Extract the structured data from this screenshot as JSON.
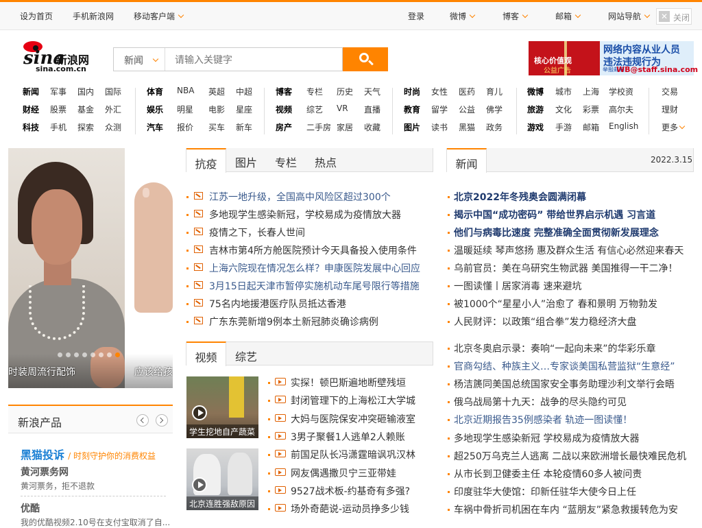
{
  "topbar": {
    "home": "设为首页",
    "mobile_sina": "手机新浪网",
    "mobile_client": "移动客户端",
    "login": "登录",
    "weibo": "微博",
    "blog": "博客",
    "mail": "邮箱",
    "site_nav": "网站导航",
    "close": "关闭",
    "close_x": "✕"
  },
  "logo": {
    "brand_sina": "sina",
    "brand_cn": "新浪网",
    "domain": "sina.com.cn"
  },
  "search": {
    "category": "新闻",
    "placeholder": "请输入关键字"
  },
  "ad": {
    "left_line1": "核心价值观",
    "left_line2": "公益广告",
    "right_line1": "网络内容从业人员",
    "right_line2": "违法违规行为",
    "right_email": "WB@staff.sina.com",
    "right_tag": "举报邮箱"
  },
  "nav": {
    "g1": [
      [
        "新闻",
        "军事",
        "国内",
        "国际"
      ],
      [
        "财经",
        "股票",
        "基金",
        "外汇"
      ],
      [
        "科技",
        "手机",
        "探索",
        "众测"
      ]
    ],
    "g2": [
      [
        "体育",
        "NBA",
        "英超",
        "中超"
      ],
      [
        "娱乐",
        "明星",
        "电影",
        "星座"
      ],
      [
        "汽车",
        "报价",
        "买车",
        "新车"
      ]
    ],
    "g3": [
      [
        "博客",
        "专栏",
        "历史",
        "天气"
      ],
      [
        "视频",
        "综艺",
        "VR",
        "直播"
      ],
      [
        "房产",
        "二手房",
        "家居",
        "收藏"
      ]
    ],
    "g4": [
      [
        "时尚",
        "女性",
        "医药",
        "育儿"
      ],
      [
        "教育",
        "留学",
        "公益",
        "佛学"
      ],
      [
        "图片",
        "读书",
        "黑猫",
        "政务"
      ]
    ],
    "g5": [
      [
        "微博",
        "城市",
        "上海",
        "学校资"
      ],
      [
        "旅游",
        "文化",
        "彩票",
        "高尔夫"
      ],
      [
        "游戏",
        "手游",
        "邮箱",
        "English"
      ]
    ],
    "g6": [
      "交易",
      "理财",
      "更多"
    ]
  },
  "carousel": {
    "caption1": "时装周流行配饰",
    "caption2": "应该给孩"
  },
  "products": {
    "title": "新浪产品",
    "items": [
      {
        "name": "黑猫投诉",
        "slogan": "/ 时刻守护你的消费权益"
      },
      {
        "name": "黄河票务网",
        "desc": "黄河票务，拒不退款"
      },
      {
        "name": "优酷",
        "desc": "我的优酷视频2.10号在支付宝取消了自..."
      }
    ]
  },
  "left_tabs": [
    "抗疫",
    "图片",
    "专栏",
    "热点"
  ],
  "left_news": [
    "江苏一地升级，全国高中风险区超过300个",
    "多地现学生感染新冠，学校易成为疫情放大器",
    "疫情之下，长春人世间",
    "吉林市第4所方舱医院预计今天具备投入使用条件",
    "上海六院现在情况怎么样？申康医院发展中心回应",
    "3月15日起天津市暂停实施机动车尾号限行等措施",
    "75名内地援港医疗队员抵达香港",
    "广东东莞新增9例本土新冠肺炎确诊病例"
  ],
  "video_tabs": [
    "视频",
    "综艺"
  ],
  "video_thumbs": [
    "学生挖地自产蔬菜",
    "北京连胜强敌原因"
  ],
  "video_news": [
    "实探！顿巴斯遍地断壁残垣",
    "封闭管理下的上海松江大学城",
    "大妈与医院保安冲突砸输液室",
    "3男子聚餐1人逃单2人赖账",
    "前国足队长冯潇霆暗讽巩汉林",
    "网友偶遇撒贝宁三亚带娃",
    "9527战术板-约基奇有多强?",
    "场外奇葩说-运动员挣多少钱"
  ],
  "right_tab": "新闻",
  "date": "2022.3.15",
  "right_headlines": [
    "北京2022年冬残奥会圆满闭幕",
    "揭示中国“成功密码” 带给世界启示机遇 习言道",
    "他们与病毒比速度 完整准确全面贯彻新发展理念"
  ],
  "right_news1": [
    "温暖延续 琴声悠扬 惠及群众生活 有信心必然迎来春天",
    "乌前官员：美在乌研究生物武器 美国推得一干二净！",
    "一图读懂丨居家消毒 速来避坑",
    "被1000个“星星小人”治愈了 春和景明 万物勃发",
    "人民财评：以政策“组合拳”发力稳经济大盘"
  ],
  "right_news2": [
    "北京冬奥启示录：奏响“一起向未来”的华彩乐章",
    "官商勾结、种族主义…专家谈美国私营监狱“生意经”",
    "杨洁篪同美国总统国家安全事务助理沙利文举行会晤",
    "俄乌战局第十九天：战争的尽头隐约可见",
    "北京近期报告35例感染者 轨迹一图读懂！",
    "多地现学生感染新冠 学校易成为疫情放大器",
    "超250万乌克兰人逃离 二战以来欧洲增长最快难民危机",
    "从市长到卫健委主任 本轮疫情60多人被问责",
    "印度驻华大使馆：印新任驻华大使今日上任",
    "车祸中骨折司机困在车内 “蓝朋友”紧急救援转危为安"
  ],
  "colors": {
    "accent": "#ff8400",
    "headline": "#1f3a6e",
    "link": "#3a5a8c"
  }
}
